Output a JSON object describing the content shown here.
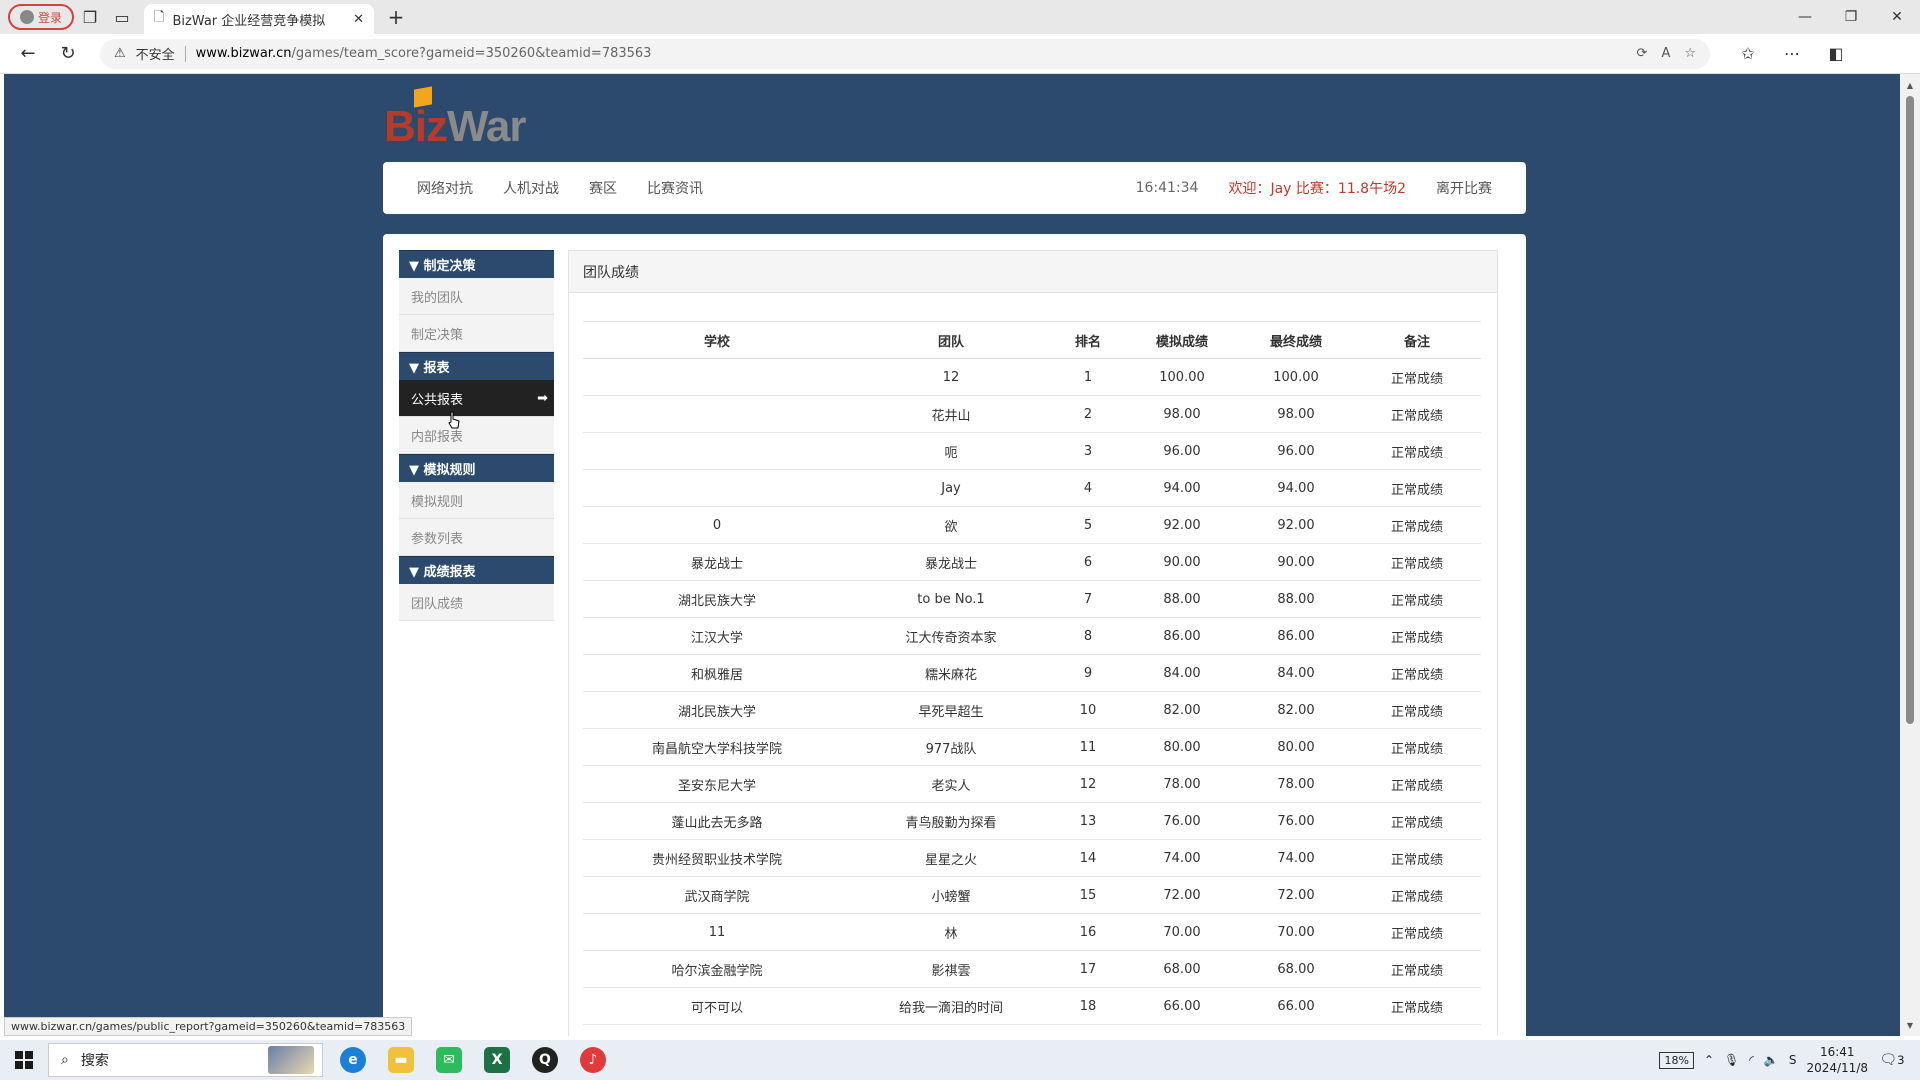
{
  "browser": {
    "profile_label": "登录",
    "tab_title": "BizWar 企业经营竞争模拟",
    "security_label": "不安全",
    "url_host": "www.bizwar.cn",
    "url_path": "/games/team_score?gameid=350260&teamid=783563",
    "status_url": "www.bizwar.cn/games/public_report?gameid=350260&teamid=783563"
  },
  "logo": {
    "part1": "Biz",
    "part2": "War"
  },
  "topnav": {
    "links": [
      "网络对抗",
      "人机对战",
      "赛区",
      "比赛资讯"
    ],
    "clock": "16:41:34",
    "welcome": "欢迎：Jay 比赛：11.8午场2",
    "leave": "离开比赛"
  },
  "sidebar": {
    "sections": [
      {
        "title": "▼ 制定决策",
        "items": [
          "我的团队",
          "制定决策"
        ]
      },
      {
        "title": "▼ 报表",
        "items": [
          "公共报表",
          "内部报表"
        ]
      },
      {
        "title": "▼ 模拟规则",
        "items": [
          "模拟规则",
          "参数列表"
        ]
      },
      {
        "title": "▼ 成绩报表",
        "items": [
          "团队成绩"
        ]
      }
    ],
    "active_item": "公共报表"
  },
  "panel": {
    "title": "团队成绩",
    "columns": [
      "学校",
      "团队",
      "排名",
      "模拟成绩",
      "最终成绩",
      "备注"
    ],
    "rows": [
      [
        "",
        "12",
        "1",
        "100.00",
        "100.00",
        "正常成绩"
      ],
      [
        "",
        "花井山",
        "2",
        "98.00",
        "98.00",
        "正常成绩"
      ],
      [
        "",
        "呃",
        "3",
        "96.00",
        "96.00",
        "正常成绩"
      ],
      [
        "",
        "Jay",
        "4",
        "94.00",
        "94.00",
        "正常成绩"
      ],
      [
        "0",
        "欲",
        "5",
        "92.00",
        "92.00",
        "正常成绩"
      ],
      [
        "暴龙战士",
        "暴龙战士",
        "6",
        "90.00",
        "90.00",
        "正常成绩"
      ],
      [
        "湖北民族大学",
        "to be No.1",
        "7",
        "88.00",
        "88.00",
        "正常成绩"
      ],
      [
        "江汉大学",
        "江大传奇资本家",
        "8",
        "86.00",
        "86.00",
        "正常成绩"
      ],
      [
        "和枫雅居",
        "糯米麻花",
        "9",
        "84.00",
        "84.00",
        "正常成绩"
      ],
      [
        "湖北民族大学",
        "早死早超生",
        "10",
        "82.00",
        "82.00",
        "正常成绩"
      ],
      [
        "南昌航空大学科技学院",
        "977战队",
        "11",
        "80.00",
        "80.00",
        "正常成绩"
      ],
      [
        "圣安东尼大学",
        "老实人",
        "12",
        "78.00",
        "78.00",
        "正常成绩"
      ],
      [
        "蓬山此去无多路",
        "青鸟殷勤为探看",
        "13",
        "76.00",
        "76.00",
        "正常成绩"
      ],
      [
        "贵州经贸职业技术学院",
        "星星之火",
        "14",
        "74.00",
        "74.00",
        "正常成绩"
      ],
      [
        "武汉商学院",
        "小螃蟹",
        "15",
        "72.00",
        "72.00",
        "正常成绩"
      ],
      [
        "11",
        "林",
        "16",
        "70.00",
        "70.00",
        "正常成绩"
      ],
      [
        "哈尔滨金融学院",
        "影祺雲",
        "17",
        "68.00",
        "68.00",
        "正常成绩"
      ],
      [
        "可不可以",
        "给我一滴泪的时间",
        "18",
        "66.00",
        "66.00",
        "正常成绩"
      ]
    ]
  },
  "taskbar": {
    "search_label": "搜索",
    "battery": "18%",
    "time": "16:41",
    "date": "2024/11/8",
    "notifications": "3"
  }
}
